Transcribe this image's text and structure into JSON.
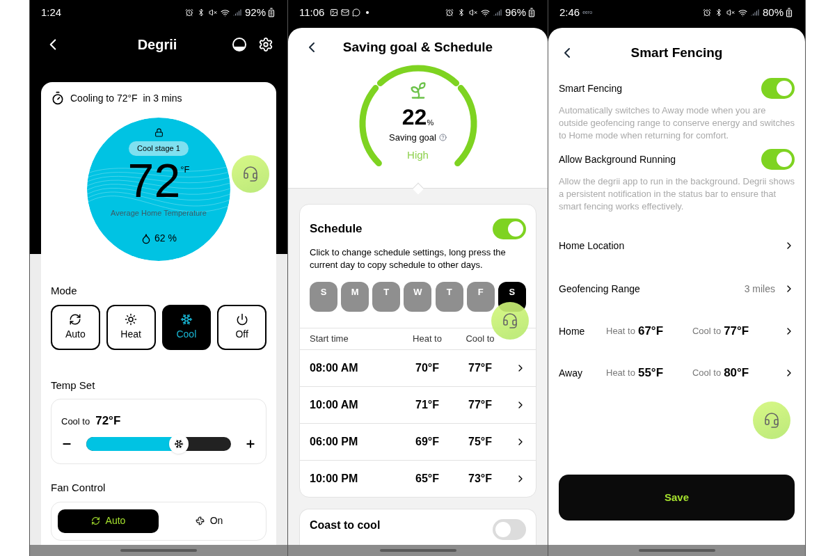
{
  "thermostat_screen": {
    "status_bar": {
      "time": "1:24",
      "battery": "92%"
    },
    "title": "Degrii",
    "status_line": "Cooling to 72°F  in 3 mins",
    "dial": {
      "stage": "Cool stage 1",
      "temperature": "72",
      "unit": "°F",
      "caption": "Average Home Temperature",
      "humidity": "62 %"
    },
    "mode": {
      "label": "Mode",
      "options": [
        {
          "label": "Auto",
          "kind": "auto",
          "selected": false
        },
        {
          "label": "Heat",
          "kind": "heat",
          "selected": false
        },
        {
          "label": "Cool",
          "kind": "cool",
          "selected": true
        },
        {
          "label": "Off",
          "kind": "off",
          "selected": false
        }
      ]
    },
    "temp_set": {
      "label": "Temp Set",
      "target_label": "Cool to",
      "target_value": "72°F",
      "level": 0.64
    },
    "fan_control": {
      "label": "Fan Control",
      "options": [
        {
          "label": "Auto",
          "kind": "auto",
          "selected": true
        },
        {
          "label": "On",
          "kind": "on",
          "selected": false
        }
      ]
    }
  },
  "schedule_screen": {
    "status_bar": {
      "time": "11:06",
      "battery": "96%"
    },
    "title": "Saving goal & Schedule",
    "goal": {
      "value": "22",
      "unit": "%",
      "label": "Saving goal",
      "rating": "High"
    },
    "schedule": {
      "title": "Schedule",
      "on": true,
      "description": "Click to change schedule settings, long press the current day to copy schedule to other days.",
      "days": [
        {
          "label": "S",
          "selected": false
        },
        {
          "label": "M",
          "selected": false
        },
        {
          "label": "T",
          "selected": false
        },
        {
          "label": "W",
          "selected": false
        },
        {
          "label": "T",
          "selected": false
        },
        {
          "label": "F",
          "selected": false
        },
        {
          "label": "S",
          "selected": true
        }
      ],
      "columns": [
        "Start time",
        "Heat to",
        "Cool to"
      ],
      "rows": [
        {
          "start": "08:00 AM",
          "heat": "70°F",
          "cool": "77°F"
        },
        {
          "start": "10:00 AM",
          "heat": "71°F",
          "cool": "77°F"
        },
        {
          "start": "06:00 PM",
          "heat": "69°F",
          "cool": "75°F"
        },
        {
          "start": "10:00 PM",
          "heat": "65°F",
          "cool": "73°F"
        }
      ]
    },
    "coast_to_cool": {
      "title": "Coast to cool",
      "on": false
    }
  },
  "smart_fencing_screen": {
    "status_bar": {
      "time": "2:46",
      "carrier": "eero",
      "battery": "80%"
    },
    "title": "Smart Fencing",
    "toggles": [
      {
        "label": "Smart Fencing",
        "on": true,
        "description": "Automatically switches to Away mode when you are outside geofencing range to conserve energy and switches to Home mode when returning for comfort."
      },
      {
        "label": "Allow Background Running",
        "on": true,
        "description": "Allow the degrii app to run in the background. Degrii shows a persistent notification in the status bar to ensure that smart fencing works effectively."
      }
    ],
    "rows": [
      {
        "kind": "link",
        "label": "Home Location"
      },
      {
        "kind": "value",
        "label": "Geofencing Range",
        "value": "3 miles"
      },
      {
        "kind": "temps",
        "label": "Home",
        "heat_label": "Heat to",
        "heat": "67°F",
        "cool_label": "Cool to",
        "cool": "77°F"
      },
      {
        "kind": "temps",
        "label": "Away",
        "heat_label": "Heat to",
        "heat": "55°F",
        "cool_label": "Cool to",
        "cool": "80°F"
      }
    ],
    "save": "Save"
  }
}
